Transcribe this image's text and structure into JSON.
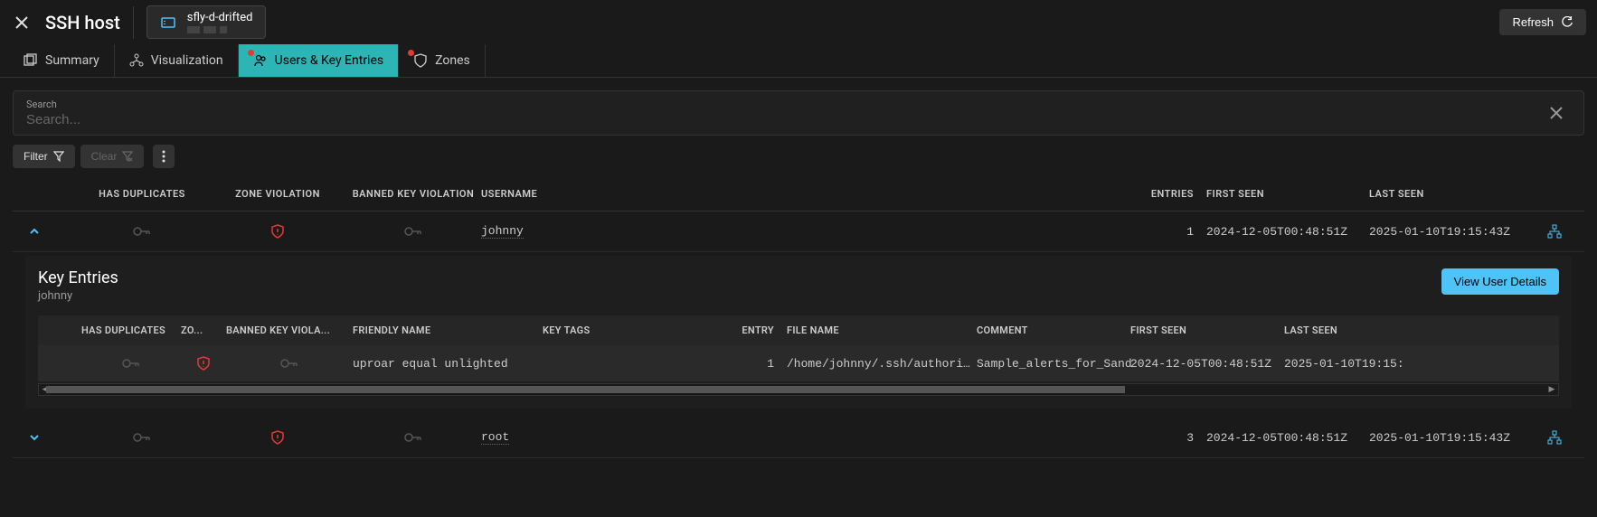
{
  "header": {
    "title": "SSH host",
    "host_name": "sfly-d-drifted",
    "refresh_label": "Refresh"
  },
  "tabs": [
    {
      "label": "Summary",
      "active": false,
      "has_dot": false
    },
    {
      "label": "Visualization",
      "active": false,
      "has_dot": false
    },
    {
      "label": "Users & Key Entries",
      "active": true,
      "has_dot": true
    },
    {
      "label": "Zones",
      "active": false,
      "has_dot": true
    }
  ],
  "search": {
    "label": "Search",
    "placeholder": "Search..."
  },
  "filter_bar": {
    "filter_label": "Filter",
    "clear_label": "Clear"
  },
  "users_table": {
    "columns": {
      "has_duplicates": "HAS DUPLICATES",
      "zone_violation": "ZONE VIOLATION",
      "banned_key_violation": "BANNED KEY VIOLATION",
      "username": "USERNAME",
      "entries": "ENTRIES",
      "first_seen": "FIRST SEEN",
      "last_seen": "LAST SEEN"
    },
    "rows": [
      {
        "expanded": true,
        "username": "johnny",
        "entries": "1",
        "first_seen": "2024-12-05T00:48:51Z",
        "last_seen": "2025-01-10T19:15:43Z",
        "zone_violation": true
      },
      {
        "expanded": false,
        "username": "root",
        "entries": "3",
        "first_seen": "2024-12-05T00:48:51Z",
        "last_seen": "2025-01-10T19:15:43Z",
        "zone_violation": true
      }
    ]
  },
  "details": {
    "title": "Key Entries",
    "subtitle": "johnny",
    "button_label": "View User Details",
    "columns": {
      "has_duplicates": "HAS DUPLICATES",
      "zone": "ZO...",
      "banned_key": "BANNED KEY VIOLA...",
      "friendly_name": "FRIENDLY NAME",
      "key_tags": "KEY TAGS",
      "entry": "ENTRY",
      "file_name": "FILE NAME",
      "comment": "COMMENT",
      "first_seen": "FIRST SEEN",
      "last_seen": "LAST SEEN"
    },
    "row": {
      "friendly_name": "uproar equal unlighted",
      "entry": "1",
      "file_name": "/home/johnny/.ssh/authori…",
      "comment": "Sample_alerts_for_Sand",
      "first_seen": "2024-12-05T00:48:51Z",
      "last_seen": "2025-01-10T19:15:"
    }
  }
}
